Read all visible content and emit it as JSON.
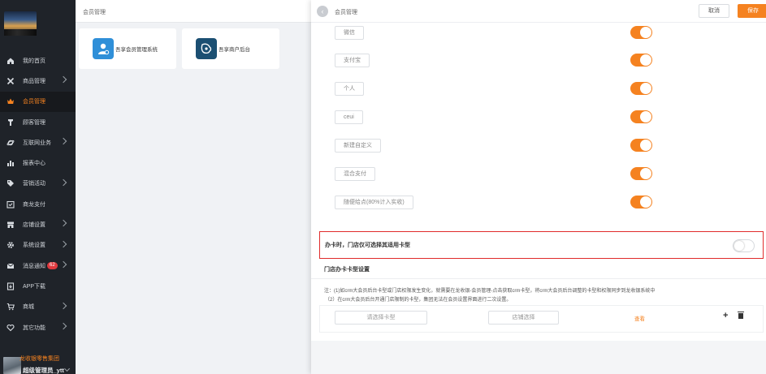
{
  "sidebar": {
    "items": [
      {
        "label": "我的首页",
        "icon": "home-icon",
        "arrow": false,
        "active": false
      },
      {
        "label": "商品管理",
        "icon": "tools-icon",
        "arrow": true,
        "active": false
      },
      {
        "label": "会员管理",
        "icon": "crown-icon",
        "arrow": false,
        "active": true
      },
      {
        "label": "顾客管理",
        "icon": "customer-icon",
        "arrow": false,
        "active": false
      },
      {
        "label": "互联网业务",
        "icon": "planet-icon",
        "arrow": true,
        "active": false
      },
      {
        "label": "报表中心",
        "icon": "chart-icon",
        "arrow": false,
        "active": false
      },
      {
        "label": "营销活动",
        "icon": "tag-icon",
        "arrow": true,
        "active": false
      },
      {
        "label": "商龙支付",
        "icon": "pay-check-icon",
        "arrow": false,
        "active": false
      },
      {
        "label": "店铺设置",
        "icon": "store-icon",
        "arrow": true,
        "active": false
      },
      {
        "label": "系统设置",
        "icon": "gear-icon",
        "arrow": true,
        "active": false
      },
      {
        "label": "消息通知",
        "icon": "mail-icon",
        "arrow": true,
        "active": false,
        "badge": "62"
      },
      {
        "label": "APP下载",
        "icon": "download-icon",
        "arrow": false,
        "active": false
      },
      {
        "label": "商城",
        "icon": "cart-icon",
        "arrow": true,
        "active": false
      },
      {
        "label": "其它功能",
        "icon": "heart-icon",
        "arrow": true,
        "active": false
      }
    ],
    "org_name": "龙收银零售集团",
    "user_name": "超级管理员_ytt"
  },
  "middle": {
    "title": "会员管理",
    "cards": [
      {
        "label": "吾享会员管理系统",
        "icon": "member-system-icon",
        "color": "#2f8fd8"
      },
      {
        "label": "吾享商户后台",
        "icon": "merchant-backend-icon",
        "color": "#1b4f72"
      }
    ]
  },
  "drawer": {
    "title": "会员管理",
    "cancel_label": "取消",
    "save_label": "保存",
    "payment_methods": [
      {
        "label": "微信",
        "enabled": true
      },
      {
        "label": "支付宝",
        "enabled": true
      },
      {
        "label": "个人",
        "enabled": true
      },
      {
        "label": "ceui",
        "enabled": true
      },
      {
        "label": "新建自定义",
        "enabled": true
      },
      {
        "label": "混合支付",
        "enabled": true
      },
      {
        "label": "随便给点(80%计入实收)",
        "enabled": true
      }
    ],
    "card_limit": {
      "label": "办卡时，门店仅可选择其适用卡型",
      "enabled": false
    },
    "section_title": "门店办卡卡型设置",
    "notes": [
      "注：(1)如crm大会员后台卡型或门店权限发生变化，就需要在龙收银-会员管理-点击获取crm卡型，将crm大会员后台调整的卡型和权限同步到龙收银系统中",
      "（2）在crm大会员后台开通门店限制的卡型，集团无法在会员设置界面进行二次设置。"
    ],
    "card_type_placeholder": "请选择卡型",
    "store_select_placeholder": "店铺选择",
    "view_label": "查看",
    "accent_color": "#f58220"
  }
}
